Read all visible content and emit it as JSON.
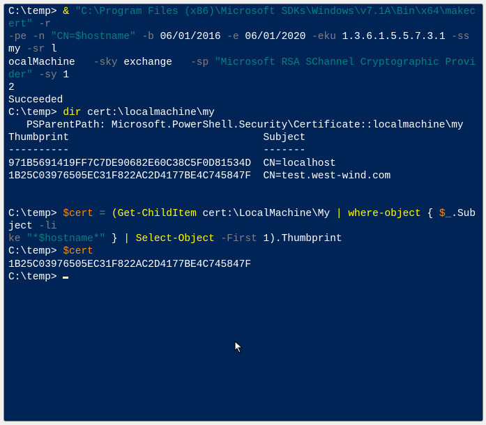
{
  "line1": {
    "prompt": "C:\\temp>",
    "amp": " & ",
    "makecert_path": "\"C:\\Program Files (x86)\\Microsoft SDKs\\Windows\\v7.1A\\Bin\\x64\\makecert\"",
    "flag_r": " -r "
  },
  "line2": {
    "pe": "-pe",
    "n": " -n ",
    "cn": "\"CN=$hostname\"",
    "b": " -b ",
    "date1": "06/01/2016",
    "e": " -e ",
    "date2": "06/01/2020",
    "eku": " -eku ",
    "oid": "1.3.6.1.5.5.7.3.1",
    "ss": " -ss ",
    "my": "my",
    "sr": " -sr ",
    "l": "l"
  },
  "line3": {
    "ocalmachine": "ocalMachine",
    "sky": "   -sky ",
    "exchange": "exchange",
    "sp": "   -sp ",
    "provider": "\"Microsoft RSA SChannel Cryptographic Provider\"",
    "sy": " -sy ",
    "one": "1"
  },
  "line4": "2",
  "line5": "Succeeded",
  "line6": {
    "prompt": "C:\\temp>",
    "cmd": " dir ",
    "path": "cert:\\localmachine\\my"
  },
  "blank1": "",
  "blank2": "",
  "parentpath": "   PSParentPath: Microsoft.PowerShell.Security\\Certificate::localmachine\\my",
  "blank3": "",
  "header": {
    "thumb": "Thumbprint",
    "spacer": "                                ",
    "subj": "Subject"
  },
  "divider": {
    "thumb": "----------",
    "spacer": "                                ",
    "subj": "-------"
  },
  "row1": {
    "thumb": "971B5691419FF7C7DE90682E60C38C5F0D81534D",
    "sep": "  ",
    "subj": "CN=localhost"
  },
  "row2": {
    "thumb": "1B25C03976505EC31F822AC2D4177BE4C745847F",
    "sep": "  ",
    "subj": "CN=test.west-wind.com"
  },
  "cmdline1": {
    "prompt": "C:\\temp>",
    "sp1": " ",
    "var": "$cert",
    "eq": " = ",
    "paren": "(",
    "gci": "Get-ChildItem",
    "path": " cert:\\LocalMachine\\My ",
    "pipe1": "|",
    "sp2": " ",
    "where": "where-object",
    "brace": " { ",
    "subj": "$_",
    "dotsubj": ".Subject ",
    "li": "-li"
  },
  "cmdline2": {
    "ke": "ke",
    "pattern": " \"*$hostname*\"",
    "brace2": " } ",
    "pipe2": "|",
    "sp": " ",
    "select": "Select-Object",
    "first": " -First",
    "one": " 1",
    "close": ")",
    "thumb": ".Thumbprint"
  },
  "cmdline3": {
    "prompt": "C:\\temp>",
    "sp": " ",
    "var": "$cert"
  },
  "output": "1B25C03976505EC31F822AC2D4177BE4C745847F",
  "finalprompt": "C:\\temp> "
}
